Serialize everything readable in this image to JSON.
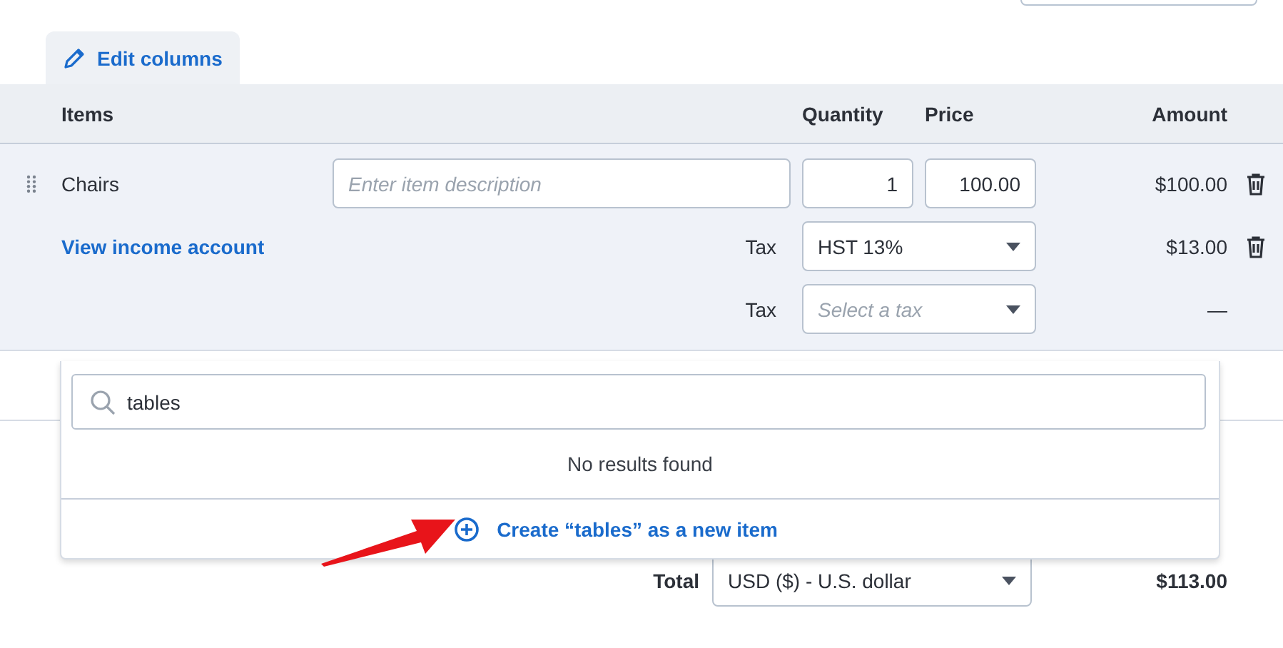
{
  "tab": {
    "label": "Edit columns"
  },
  "columns": [
    "Items",
    "Quantity",
    "Price",
    "Amount"
  ],
  "line_item": {
    "name": "Chairs",
    "description": {
      "placeholder": "Enter item description"
    },
    "quantity": "1",
    "price": "100.00",
    "amount": "$100.00"
  },
  "link": "View income account",
  "taxes": [
    {
      "label": "Tax",
      "value": "HST 13%",
      "amount": "$13.00",
      "deletable": true
    },
    {
      "label": "Tax",
      "placeholder": "Select a tax",
      "amount": "—",
      "deletable": false
    }
  ],
  "total": {
    "label": "Total",
    "currency": "USD ($) - U.S. dollar",
    "amount": "$113.00"
  },
  "dropdown": {
    "search": "tables",
    "message": "No results found",
    "create": "Create “tables” as a new item"
  }
}
